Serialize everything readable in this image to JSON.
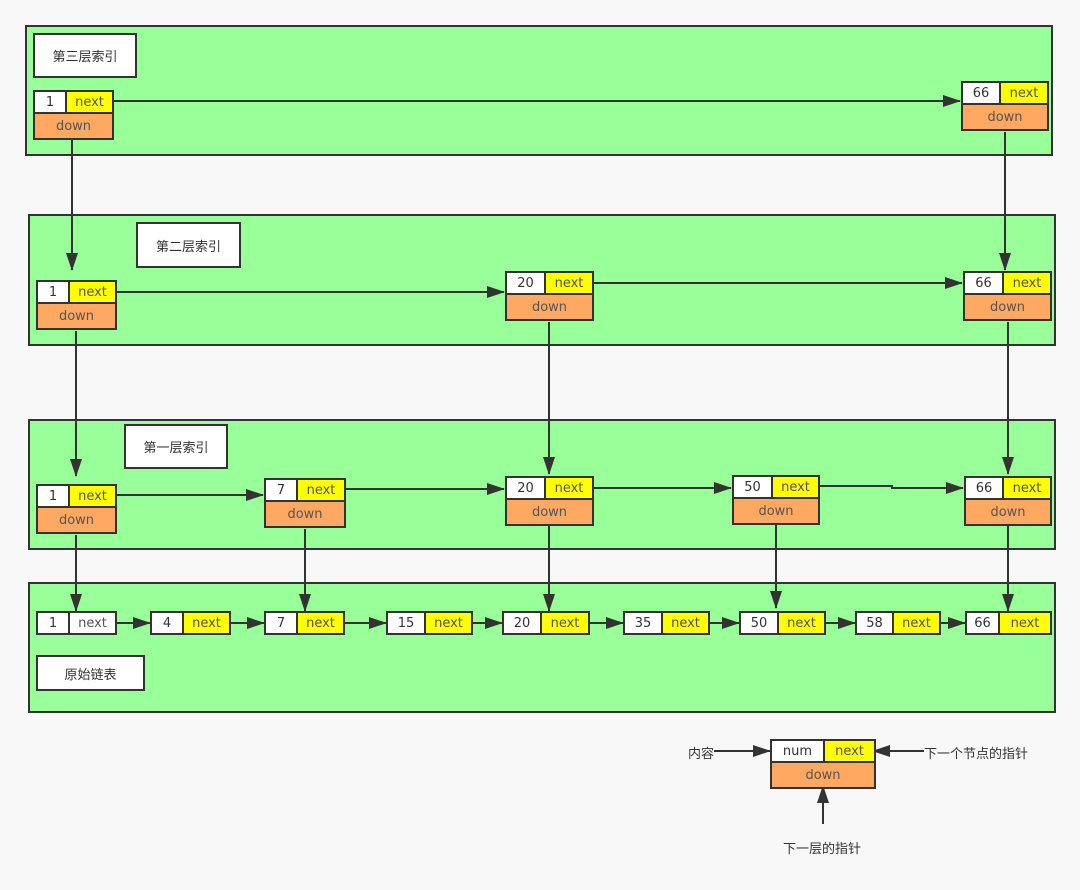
{
  "colors": {
    "layer_bg": "#99ff99",
    "next_field": "#ffff00",
    "down_field": "#ffa862",
    "num_field": "#ffffff",
    "stroke": "#333333"
  },
  "layers": [
    {
      "title": "第三层索引",
      "nodes": [
        {
          "num": "1",
          "next": "next",
          "down": "down"
        },
        {
          "num": "66",
          "next": "next",
          "down": "down"
        }
      ]
    },
    {
      "title": "第二层索引",
      "nodes": [
        {
          "num": "1",
          "next": "next",
          "down": "down"
        },
        {
          "num": "20",
          "next": "next",
          "down": "down"
        },
        {
          "num": "66",
          "next": "next",
          "down": "down"
        }
      ]
    },
    {
      "title": "第一层索引",
      "nodes": [
        {
          "num": "1",
          "next": "next",
          "down": "down"
        },
        {
          "num": "7",
          "next": "next",
          "down": "down"
        },
        {
          "num": "20",
          "next": "next",
          "down": "down"
        },
        {
          "num": "50",
          "next": "next",
          "down": "down"
        },
        {
          "num": "66",
          "next": "next",
          "down": "down"
        }
      ]
    },
    {
      "title": "原始链表",
      "nodes": [
        {
          "num": "1",
          "next": "next"
        },
        {
          "num": "4",
          "next": "next"
        },
        {
          "num": "7",
          "next": "next"
        },
        {
          "num": "15",
          "next": "next"
        },
        {
          "num": "20",
          "next": "next"
        },
        {
          "num": "35",
          "next": "next"
        },
        {
          "num": "50",
          "next": "next"
        },
        {
          "num": "58",
          "next": "next"
        },
        {
          "num": "66",
          "next": "next"
        }
      ]
    }
  ],
  "legend": {
    "node": {
      "num": "num",
      "next": "next",
      "down": "down"
    },
    "content_label": "内容",
    "next_pointer_label": "下一个节点的指针",
    "down_pointer_label": "下一层的指针"
  }
}
